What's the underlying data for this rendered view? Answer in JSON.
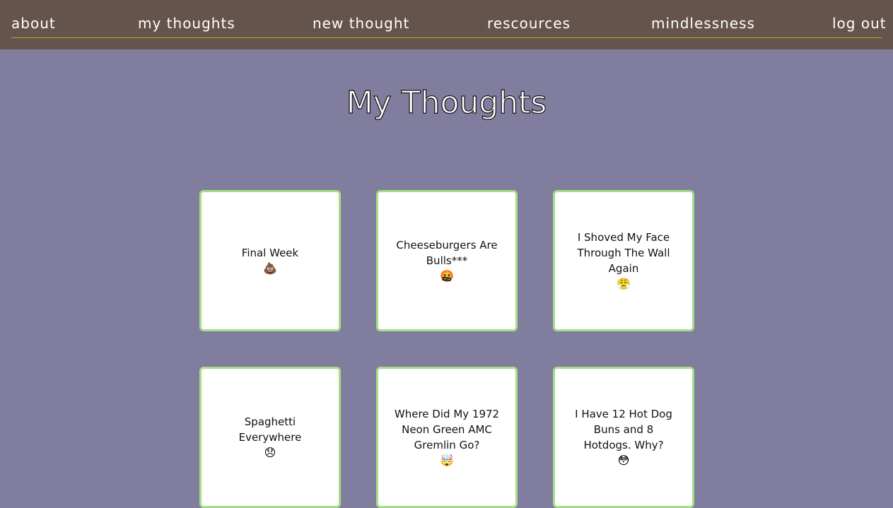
{
  "nav": {
    "items": [
      {
        "label": "about"
      },
      {
        "label": "my thoughts"
      },
      {
        "label": "new thought"
      },
      {
        "label": "rescources"
      },
      {
        "label": "mindlessness"
      },
      {
        "label": "log out"
      }
    ],
    "accent_color": "#c99a38",
    "background_color": "#65544c"
  },
  "page": {
    "title": "My Thoughts",
    "background_color": "#817d9e"
  },
  "cards": [
    {
      "title": "Final Week",
      "emoji": "💩"
    },
    {
      "title": "Cheeseburgers Are Bulls***",
      "emoji": "🤬"
    },
    {
      "title": "I Shoved My Face Through The Wall Again",
      "emoji": "😤"
    },
    {
      "title": "Spaghetti Everywhere",
      "emoji": "😞"
    },
    {
      "title": "Where Did My 1972 Neon Green AMC Gremlin Go?",
      "emoji": "🤯"
    },
    {
      "title": "I Have 12 Hot Dog Buns and 8 Hotdogs. Why?",
      "emoji": "😳"
    }
  ],
  "card_border_color": "#a6de85"
}
